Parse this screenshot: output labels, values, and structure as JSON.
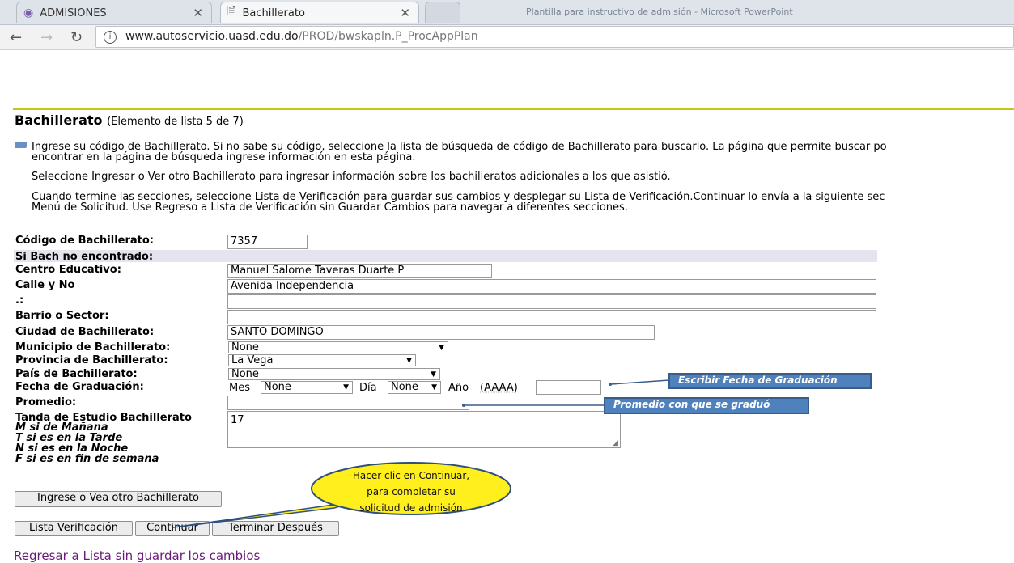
{
  "browser": {
    "tabs": [
      {
        "title": "ADMISIONES"
      },
      {
        "title": "Bachillerato"
      }
    ],
    "window_title": "Plantilla para instructivo de admisión - Microsoft PowerPoint",
    "url_host": "www.autoservicio.uasd.edu.do",
    "url_path": "/PROD/bwskapln.P_ProcAppPlan"
  },
  "page": {
    "title": "Bachillerato",
    "subtitle": "(Elemento de lista 5 de 7)",
    "info_lines": [
      "Ingrese su código de Bachillerato. Si no sabe su código, seleccione la lista de búsqueda de código de Bachillerato para buscarlo. La página que permite buscar po",
      "encontrar en la página de búsqueda ingrese información en esta página.",
      "Seleccione Ingresar o Ver otro Bachillerato para ingresar información sobre los bachilleratos adicionales a los que asistió.",
      "Cuando termine las secciones, seleccione Lista de Verificación para guardar sus cambios y desplegar su Lista de Verificación.Continuar lo envía a la siguiente sec",
      "Menú de Solicitud. Use Regreso a Lista de Verificación sin Guardar Cambios para navegar a diferentes secciones."
    ]
  },
  "form": {
    "codigo_label": "Código de Bachillerato:",
    "codigo_value": "7357",
    "si_bach_label": "Si Bach no encontrado:",
    "centro_label": "Centro Educativo:",
    "centro_value": "Manuel Salome Taveras Duarte P",
    "calle_label": "Calle y No",
    "calle_value": "Avenida  Independencia",
    "extra_label": ".:",
    "barrio_label": "Barrio o Sector:",
    "ciudad_label": "Ciudad de Bachillerato:",
    "ciudad_value": "SANTO DOMINGO",
    "municipio_label": "Municipio de Bachillerato:",
    "municipio_value": "None",
    "provincia_label": "Provincia de Bachillerato:",
    "provincia_value": "La Vega",
    "pais_label": "País de Bachillerato:",
    "pais_value": "None",
    "fecha_label": "Fecha de Graduación:",
    "mes_label": "Mes",
    "mes_value": "None",
    "dia_label": "Día",
    "dia_value": "None",
    "anio_label": "Año",
    "anio_format": "(AAAA)",
    "promedio_label": "Promedio:",
    "tanda_label": "Tanda de Estudio Bachillerato",
    "tanda_value": "17",
    "tanda_options": [
      {
        "letter": "M",
        "text": "si de Mañana"
      },
      {
        "letter": "T",
        "text": "si es en la Tarde"
      },
      {
        "letter": "N",
        "text": "si es en la Noche"
      },
      {
        "letter": "F",
        "text": "si es en fin de semana"
      }
    ]
  },
  "buttons": {
    "otro": "Ingrese o Vea otro Bachillerato",
    "lista": "Lista Verificación",
    "continuar": "Continuar",
    "terminar": "Terminar Después"
  },
  "annotations": {
    "fecha_note": "Escribir Fecha de Graduación",
    "promedio_note": "Promedio  con que se graduó",
    "bubble_lines": [
      "Hacer clic en Continuar,",
      "para completar su",
      "solicitud de admisión"
    ]
  },
  "link_text": "Regresar a Lista sin guardar los cambios",
  "colors": {
    "rule": "#c7c416",
    "callout": "#4f81bd",
    "bubble": "#ffef1c",
    "link": "#6a1b7a"
  }
}
